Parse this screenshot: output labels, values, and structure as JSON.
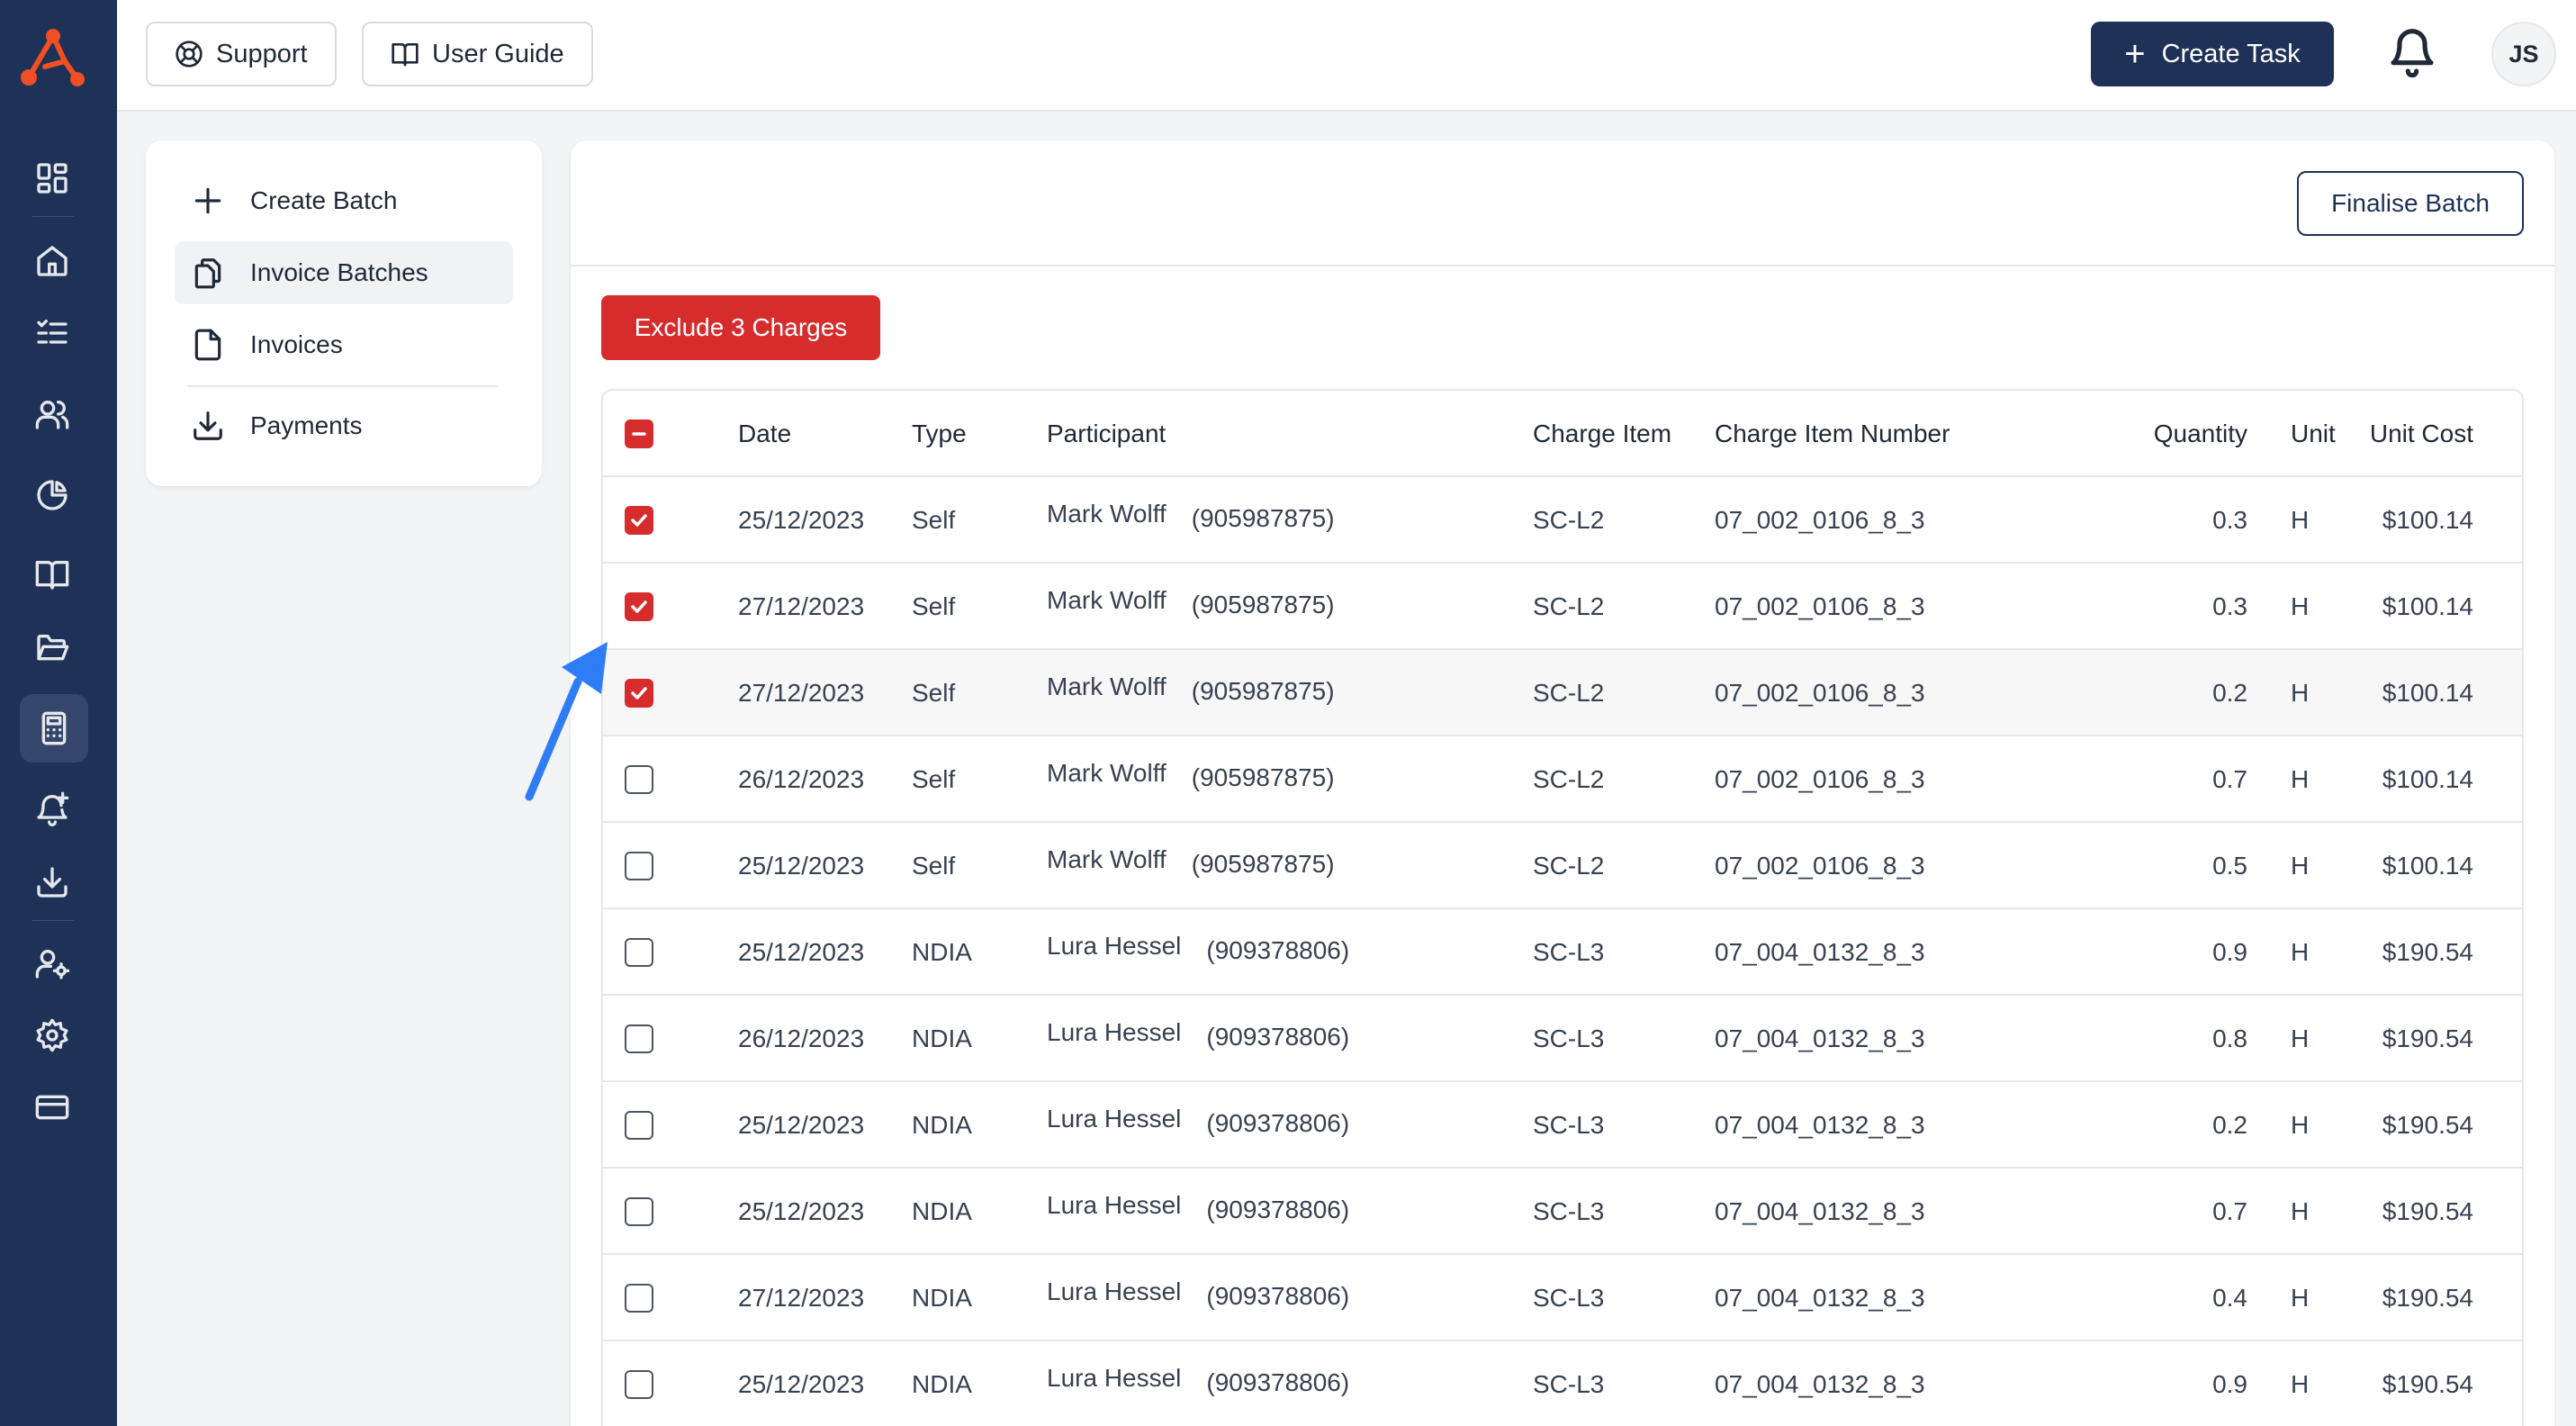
{
  "topbar": {
    "support_label": "Support",
    "user_guide_label": "User Guide",
    "create_task_label": "Create Task",
    "avatar_initials": "JS"
  },
  "side_menu": {
    "items": [
      {
        "label": "Create Batch",
        "icon": "plus-icon"
      },
      {
        "label": "Invoice Batches",
        "icon": "copy-icon",
        "active": true
      },
      {
        "label": "Invoices",
        "icon": "file-icon"
      },
      {
        "label": "Payments",
        "icon": "download-icon"
      }
    ]
  },
  "rail": {
    "icons": [
      "dashboard-icon",
      "home-icon",
      "tasks-icon",
      "users-icon",
      "pie-chart-icon",
      "book-icon",
      "folder-icon",
      "calculator-icon",
      "bell-plus-icon",
      "download-icon",
      "user-settings-icon",
      "gear-icon",
      "credit-card-icon"
    ],
    "active": "calculator-icon"
  },
  "main": {
    "finalise_label": "Finalise Batch",
    "exclude_label": "Exclude 3 Charges"
  },
  "table": {
    "columns": [
      "Date",
      "Type",
      "Participant",
      "Charge Item",
      "Charge Item Number",
      "Quantity",
      "Unit",
      "Unit Cost"
    ],
    "rows": [
      {
        "checked": true,
        "date": "25/12/2023",
        "type": "Self",
        "participant": "Mark Wolff",
        "participant_id": "(905987875)",
        "charge_item": "SC-L2",
        "charge_item_number": "07_002_0106_8_3",
        "quantity": "0.3",
        "unit": "H",
        "unit_cost": "$100.14"
      },
      {
        "checked": true,
        "date": "27/12/2023",
        "type": "Self",
        "participant": "Mark Wolff",
        "participant_id": "(905987875)",
        "charge_item": "SC-L2",
        "charge_item_number": "07_002_0106_8_3",
        "quantity": "0.3",
        "unit": "H",
        "unit_cost": "$100.14"
      },
      {
        "checked": true,
        "date": "27/12/2023",
        "type": "Self",
        "participant": "Mark Wolff",
        "participant_id": "(905987875)",
        "charge_item": "SC-L2",
        "charge_item_number": "07_002_0106_8_3",
        "quantity": "0.2",
        "unit": "H",
        "unit_cost": "$100.14"
      },
      {
        "checked": false,
        "date": "26/12/2023",
        "type": "Self",
        "participant": "Mark Wolff",
        "participant_id": "(905987875)",
        "charge_item": "SC-L2",
        "charge_item_number": "07_002_0106_8_3",
        "quantity": "0.7",
        "unit": "H",
        "unit_cost": "$100.14"
      },
      {
        "checked": false,
        "date": "25/12/2023",
        "type": "Self",
        "participant": "Mark Wolff",
        "participant_id": "(905987875)",
        "charge_item": "SC-L2",
        "charge_item_number": "07_002_0106_8_3",
        "quantity": "0.5",
        "unit": "H",
        "unit_cost": "$100.14"
      },
      {
        "checked": false,
        "date": "25/12/2023",
        "type": "NDIA",
        "participant": "Lura Hessel",
        "participant_id": "(909378806)",
        "charge_item": "SC-L3",
        "charge_item_number": "07_004_0132_8_3",
        "quantity": "0.9",
        "unit": "H",
        "unit_cost": "$190.54"
      },
      {
        "checked": false,
        "date": "26/12/2023",
        "type": "NDIA",
        "participant": "Lura Hessel",
        "participant_id": "(909378806)",
        "charge_item": "SC-L3",
        "charge_item_number": "07_004_0132_8_3",
        "quantity": "0.8",
        "unit": "H",
        "unit_cost": "$190.54"
      },
      {
        "checked": false,
        "date": "25/12/2023",
        "type": "NDIA",
        "participant": "Lura Hessel",
        "participant_id": "(909378806)",
        "charge_item": "SC-L3",
        "charge_item_number": "07_004_0132_8_3",
        "quantity": "0.2",
        "unit": "H",
        "unit_cost": "$190.54"
      },
      {
        "checked": false,
        "date": "25/12/2023",
        "type": "NDIA",
        "participant": "Lura Hessel",
        "participant_id": "(909378806)",
        "charge_item": "SC-L3",
        "charge_item_number": "07_004_0132_8_3",
        "quantity": "0.7",
        "unit": "H",
        "unit_cost": "$190.54"
      },
      {
        "checked": false,
        "date": "27/12/2023",
        "type": "NDIA",
        "participant": "Lura Hessel",
        "participant_id": "(909378806)",
        "charge_item": "SC-L3",
        "charge_item_number": "07_004_0132_8_3",
        "quantity": "0.4",
        "unit": "H",
        "unit_cost": "$190.54"
      },
      {
        "checked": false,
        "date": "25/12/2023",
        "type": "NDIA",
        "participant": "Lura Hessel",
        "participant_id": "(909378806)",
        "charge_item": "SC-L3",
        "charge_item_number": "07_004_0132_8_3",
        "quantity": "0.9",
        "unit": "H",
        "unit_cost": "$190.54"
      }
    ]
  },
  "colors": {
    "brand_navy": "#1e3157",
    "danger_red": "#d72c2c",
    "logo_orange": "#f04e23",
    "arrow_blue": "#2f7df6"
  }
}
